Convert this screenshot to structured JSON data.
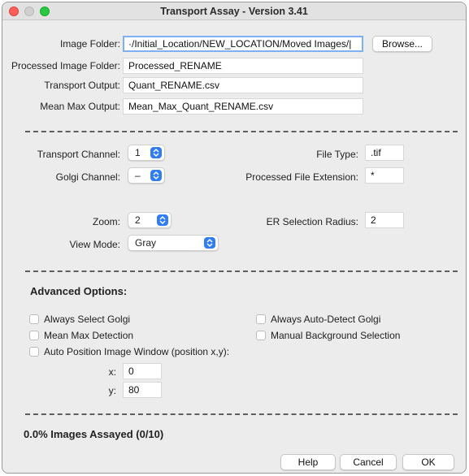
{
  "window": {
    "title": "Transport Assay - Version 3.41"
  },
  "paths": {
    "image_folder_label": "Image Folder:",
    "image_folder_value": "·/Initial_Location/NEW_LOCATION/Moved Images/|",
    "browse_label": "Browse...",
    "processed_folder_label": "Processed Image Folder:",
    "processed_folder_value": "Processed_RENAME",
    "transport_output_label": "Transport Output:",
    "transport_output_value": "Quant_RENAME.csv",
    "meanmax_output_label": "Mean Max Output:",
    "meanmax_output_value": "Mean_Max_Quant_RENAME.csv"
  },
  "channels": {
    "transport_label": "Transport Channel:",
    "transport_value": "1",
    "golgi_label": "Golgi Channel:",
    "golgi_value": "–",
    "filetype_label": "File Type:",
    "filetype_value": ".tif",
    "ext_label": "Processed File Extension:",
    "ext_value": "*"
  },
  "view": {
    "zoom_label": "Zoom:",
    "zoom_value": "2",
    "viewmode_label": "View Mode:",
    "viewmode_value": "Gray",
    "er_label": "ER Selection Radius:",
    "er_value": "2"
  },
  "advanced": {
    "title": "Advanced Options:",
    "always_select_golgi": "Always Select Golgi",
    "always_autodetect_golgi": "Always Auto-Detect Golgi",
    "mean_max_detection": "Mean Max Detection",
    "manual_bg_selection": "Manual Background Selection",
    "auto_position": "Auto Position Image Window (position x,y):",
    "x_label": "x:",
    "x_value": "0",
    "y_label": "y:",
    "y_value": "80"
  },
  "status": {
    "text": "0.0% Images Assayed (0/10)"
  },
  "buttons": {
    "help": "Help",
    "cancel": "Cancel",
    "ok": "OK"
  },
  "colors": {
    "accent": "#2f7cf6",
    "focus_ring": "#7eb0f4",
    "window_bg": "#ececec"
  }
}
